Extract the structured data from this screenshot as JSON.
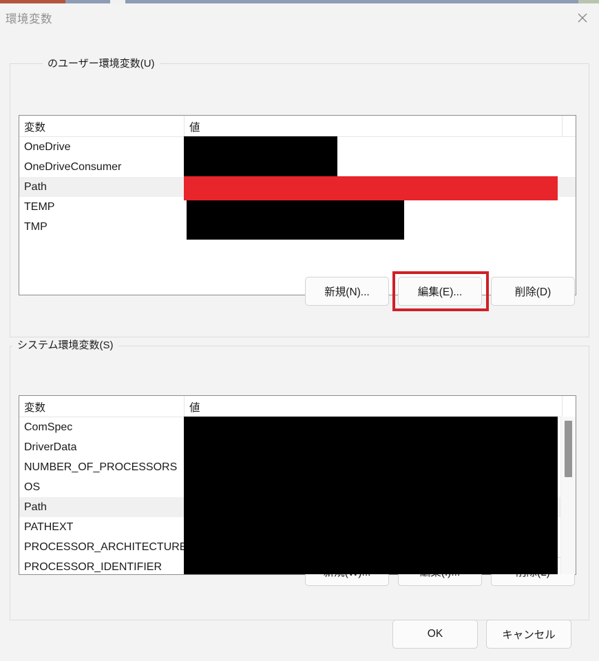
{
  "window": {
    "title": "環境変数",
    "close_icon": "close-icon"
  },
  "user_section": {
    "legend": "のユーザー環境変数(U)",
    "columns": {
      "variable": "変数",
      "value": "値"
    },
    "rows": [
      {
        "name": "OneDrive",
        "value_redacted": "black",
        "selected": false
      },
      {
        "name": "OneDriveConsumer",
        "value_redacted": "black",
        "selected": false
      },
      {
        "name": "Path",
        "value_redacted": "red",
        "selected": true
      },
      {
        "name": "TEMP",
        "value_redacted": "black",
        "selected": false
      },
      {
        "name": "TMP",
        "value_redacted": "black",
        "selected": false
      }
    ],
    "buttons": {
      "new": "新規(N)...",
      "edit": "編集(E)...",
      "delete": "削除(D)"
    }
  },
  "system_section": {
    "legend": "システム環境変数(S)",
    "columns": {
      "variable": "変数",
      "value": "値"
    },
    "rows": [
      {
        "name": "ComSpec",
        "selected": false
      },
      {
        "name": "DriverData",
        "selected": false
      },
      {
        "name": "NUMBER_OF_PROCESSORS",
        "selected": false
      },
      {
        "name": "OS",
        "selected": false
      },
      {
        "name": "Path",
        "selected": true
      },
      {
        "name": "PATHEXT",
        "selected": false
      },
      {
        "name": "PROCESSOR_ARCHITECTURE",
        "selected": false
      },
      {
        "name": "PROCESSOR_IDENTIFIER",
        "selected": false
      }
    ],
    "buttons": {
      "new": "新規(W)...",
      "edit": "編集(I)...",
      "delete": "削除(L)"
    },
    "scrollbar": {
      "thumb_position": "top"
    }
  },
  "footer": {
    "ok": "OK",
    "cancel": "キャンセル"
  },
  "annotation": {
    "target": "編集(E)...",
    "color": "#cf2027"
  },
  "colors": {
    "dialog_background": "#f3f3f3",
    "redaction_black": "#000000",
    "redaction_red": "#e8252b",
    "annotation_red": "#cf2027",
    "selection_highlight": "#f0f0f0"
  }
}
